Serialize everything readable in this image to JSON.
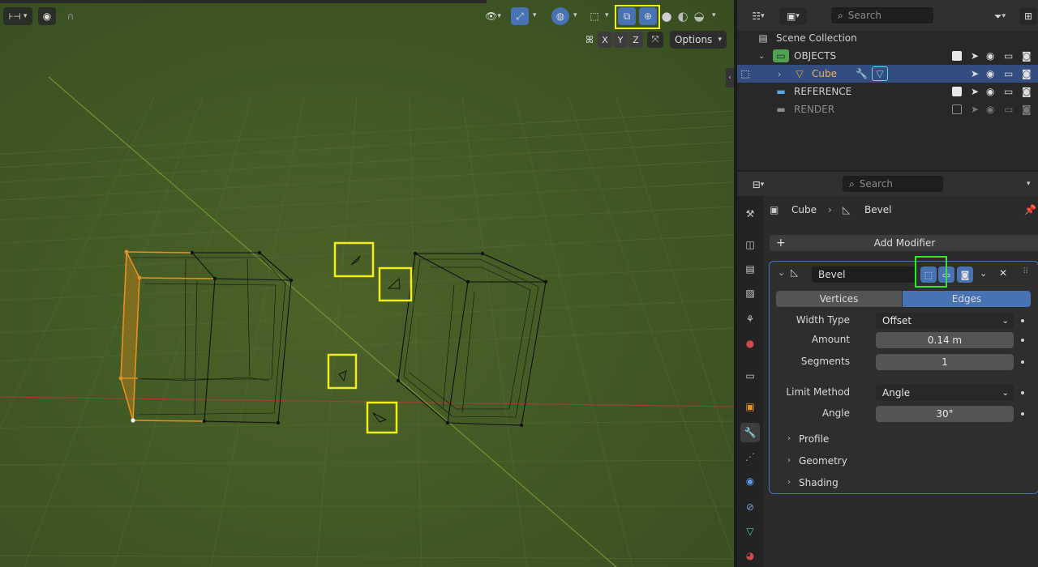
{
  "viewport": {
    "title_fragment": "",
    "axis_buttons": [
      "X",
      "Y",
      "Z"
    ],
    "options_label": "Options"
  },
  "outliner": {
    "search_placeholder": "Search",
    "scene_collection": "Scene Collection",
    "rows": [
      {
        "label": "OBJECTS",
        "type": "collection",
        "color": "#4fa24f"
      },
      {
        "label": "Cube",
        "type": "object",
        "color": "#e8a33a"
      },
      {
        "label": "REFERENCE",
        "type": "collection",
        "color": "#5aa8e0"
      },
      {
        "label": "RENDER",
        "type": "collection",
        "color": "#8c8c8c"
      }
    ]
  },
  "properties": {
    "search_placeholder": "Search",
    "breadcrumb": {
      "object": "Cube",
      "modifier": "Bevel"
    },
    "add_modifier": "Add Modifier",
    "modifier": {
      "name": "Bevel",
      "affect_tabs": [
        "Vertices",
        "Edges"
      ],
      "active_tab": "Edges",
      "fields": {
        "width_type": {
          "label": "Width Type",
          "value": "Offset"
        },
        "amount": {
          "label": "Amount",
          "value": "0.14 m"
        },
        "segments": {
          "label": "Segments",
          "value": "1"
        },
        "limit_method": {
          "label": "Limit Method",
          "value": "Angle"
        },
        "angle": {
          "label": "Angle",
          "value": "30°"
        }
      },
      "subpanels": [
        "Profile",
        "Geometry",
        "Shading"
      ]
    }
  },
  "colors": {
    "accent_blue": "#4772b3",
    "highlight_yellow": "#f2ee1e",
    "highlight_green": "#2ee82e",
    "selection_orange": "#e8901e"
  }
}
